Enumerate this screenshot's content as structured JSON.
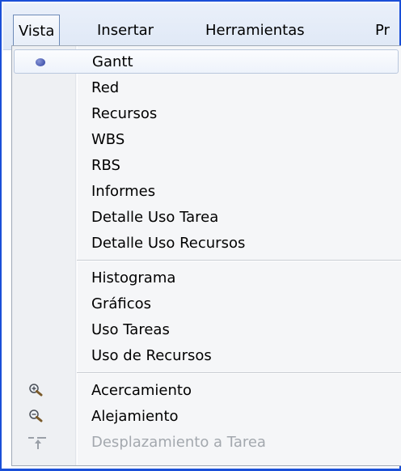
{
  "menubar": {
    "items": [
      {
        "label": "Vista",
        "active": true
      },
      {
        "label": "Insertar"
      },
      {
        "label": "Herramientas"
      },
      {
        "label": "Pr"
      }
    ]
  },
  "dropdown": {
    "group1": [
      {
        "label": "Gantt",
        "selected": true,
        "icon": "radio-bullet-icon"
      },
      {
        "label": "Red"
      },
      {
        "label": "Recursos"
      },
      {
        "label": "WBS"
      },
      {
        "label": "RBS"
      },
      {
        "label": "Informes"
      },
      {
        "label": "Detalle Uso Tarea"
      },
      {
        "label": "Detalle Uso Recursos"
      }
    ],
    "group2": [
      {
        "label": "Histograma"
      },
      {
        "label": "Gráficos"
      },
      {
        "label": "Uso Tareas"
      },
      {
        "label": "Uso de Recursos"
      }
    ],
    "group3": [
      {
        "label": "Acercamiento",
        "icon": "zoom-in-icon"
      },
      {
        "label": "Alejamiento",
        "icon": "zoom-out-icon"
      },
      {
        "label": "Desplazamiento a Tarea",
        "icon": "scroll-to-task-icon",
        "disabled": true
      }
    ]
  },
  "colors": {
    "frame_border": "#1a4fd8",
    "menubar_bg": "#dfe8f6",
    "dropdown_bg": "#f5f6f8",
    "disabled_text": "#a3a8ae"
  }
}
